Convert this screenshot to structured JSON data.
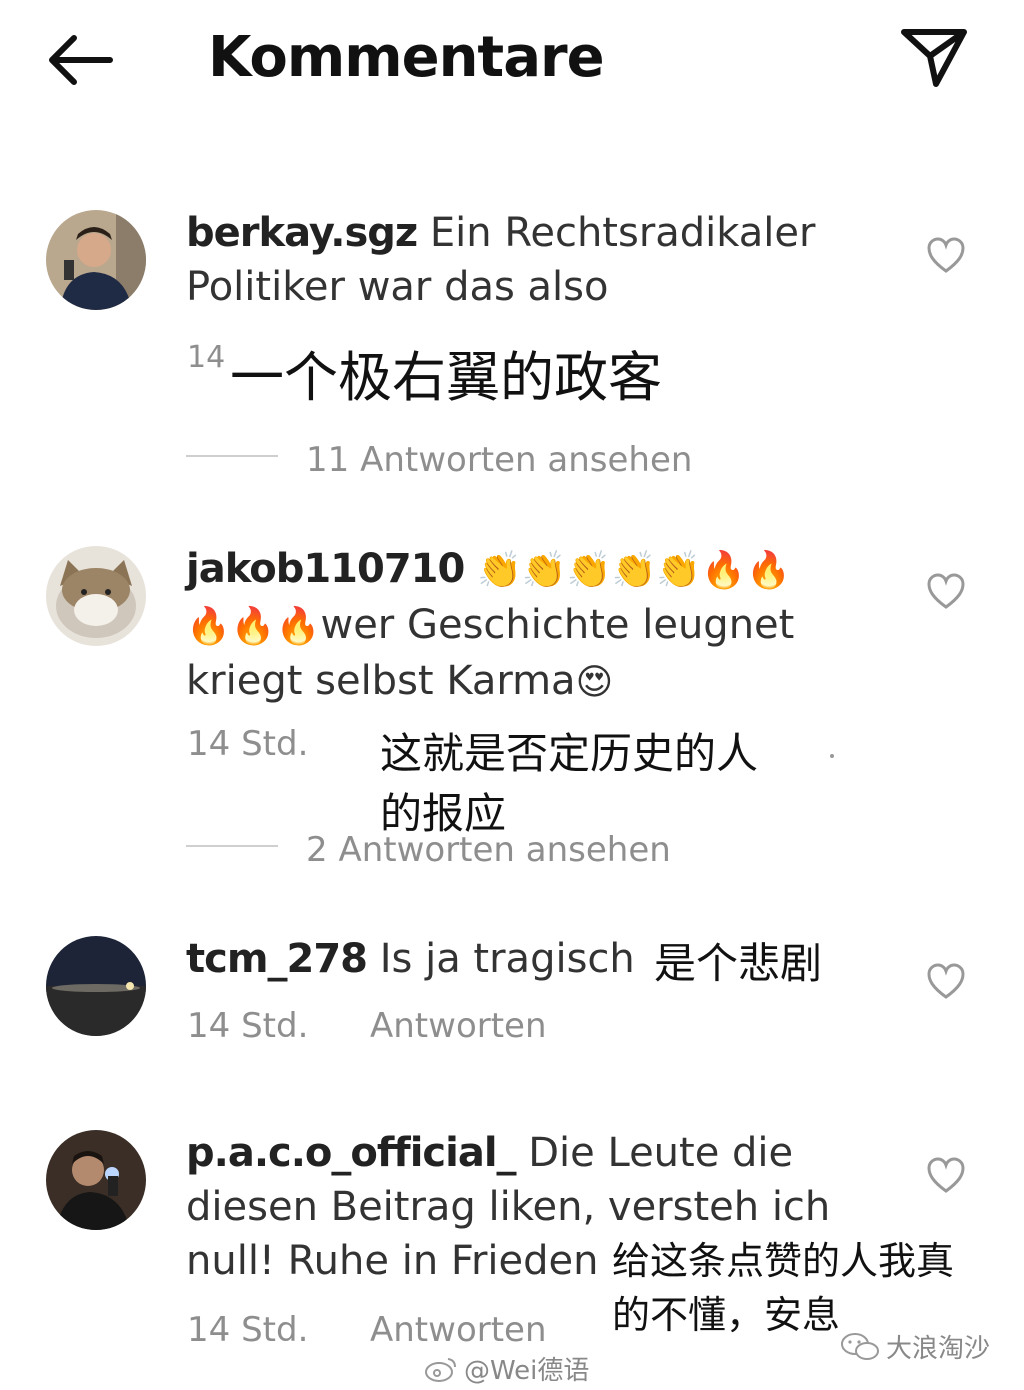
{
  "header": {
    "title": "Kommentare",
    "back_icon": "arrow-left-icon",
    "share_icon": "paper-plane-icon"
  },
  "comments": [
    {
      "username": "berkay.sgz",
      "text": "Ein Rechtsradikaler Politiker war das also",
      "time_partial": "14",
      "translation": "一个极右翼的政客",
      "view_replies": "11 Antworten ansehen"
    },
    {
      "username": "jakob110710",
      "emojis_line1": "👏👏👏👏👏🔥🔥",
      "emojis_line2": "🔥🔥🔥",
      "text_line2": "wer Geschichte leugnet",
      "text_line3": "kriegt selbst Karma",
      "emoji_end": "😍",
      "time": "14 Std.",
      "translation_line1": "这就是否定历史的人",
      "translation_line2": "的报应",
      "view_replies": "2 Antworten ansehen"
    },
    {
      "username": "tcm_278",
      "text": "Is ja tragisch",
      "translation": "是个悲剧",
      "time": "14 Std.",
      "reply": "Antworten"
    },
    {
      "username": "p.a.c.o_official_",
      "text_line1": "Die Leute die",
      "text_line2": "diesen Beitrag liken, versteh ich",
      "text_line3": "null! Ruhe in Frieden",
      "translation_line1": "给这条点赞的人我真",
      "translation_line2": "的不懂，安息",
      "time": "14 Std.",
      "reply": "Antworten"
    }
  ],
  "watermarks": {
    "weibo": "@Wei德语",
    "wechat": "大浪淘沙"
  }
}
